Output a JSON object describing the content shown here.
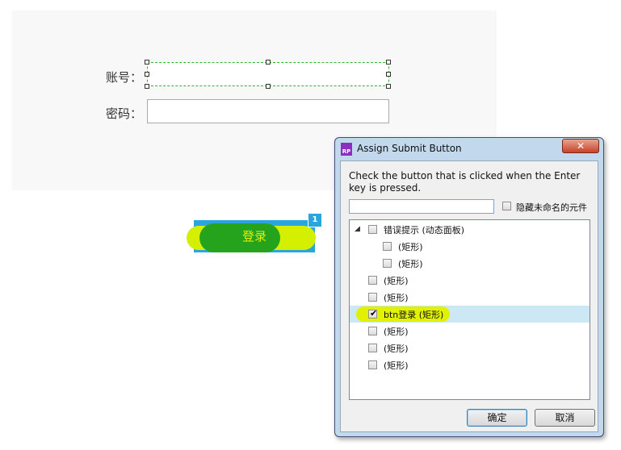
{
  "form": {
    "account_label": "账号：",
    "password_label": "密码：",
    "account_value": "",
    "password_value": "",
    "login_button_label": "登录",
    "badge_count": "1"
  },
  "dialog": {
    "app_icon_text": "RP",
    "title": "Assign Submit Button",
    "close_glyph": "✕",
    "instruction": "Check the button that is clicked when the Enter key is pressed.",
    "search_value": "",
    "hide_unnamed_label": "隐藏未命名的元件",
    "hide_unnamed_checked": false,
    "tree_items": [
      {
        "label": "错误提示 (动态面板)",
        "checked": false,
        "expanded": true,
        "level": 0
      },
      {
        "label": "(矩形)",
        "checked": false,
        "level": 1
      },
      {
        "label": "(矩形)",
        "checked": false,
        "level": 1
      },
      {
        "label": "(矩形)",
        "checked": false,
        "level": 0
      },
      {
        "label": "(矩形)",
        "checked": false,
        "level": 0
      },
      {
        "label": "btn登录 (矩形)",
        "checked": true,
        "selected": true,
        "level": 0
      },
      {
        "label": "(矩形)",
        "checked": false,
        "level": 0
      },
      {
        "label": "(矩形)",
        "checked": false,
        "level": 0
      },
      {
        "label": "(矩形)",
        "checked": false,
        "level": 0
      }
    ],
    "ok_label": "确定",
    "cancel_label": "取消"
  },
  "colors": {
    "accent_blue": "#29a6dd",
    "highlight_yellow": "#e1f200",
    "selection_green": "#2db82d"
  }
}
